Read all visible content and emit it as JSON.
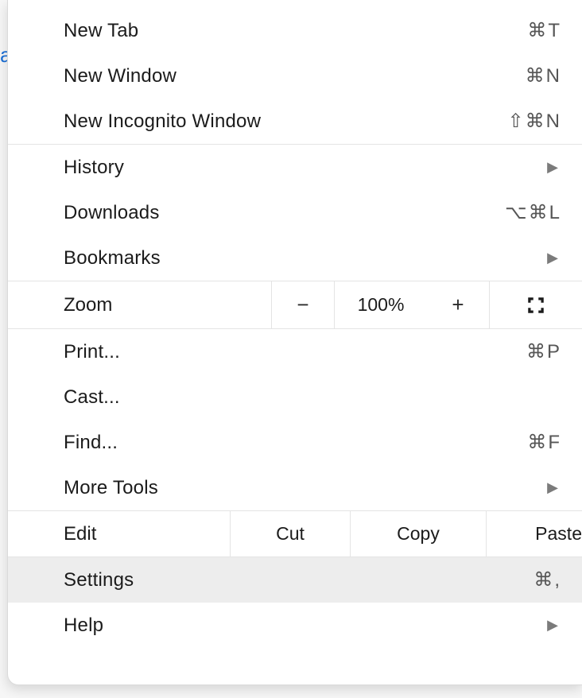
{
  "menu": {
    "items": {
      "new_tab": {
        "label": "New Tab",
        "shortcut": "⌘T"
      },
      "new_window": {
        "label": "New Window",
        "shortcut": "⌘N"
      },
      "new_incognito": {
        "label": "New Incognito Window",
        "shortcut": "⇧⌘N"
      },
      "history": {
        "label": "History"
      },
      "downloads": {
        "label": "Downloads",
        "shortcut": "⌥⌘L"
      },
      "bookmarks": {
        "label": "Bookmarks"
      },
      "zoom": {
        "label": "Zoom",
        "level": "100%",
        "minus": "−",
        "plus": "+"
      },
      "print": {
        "label": "Print...",
        "shortcut": "⌘P"
      },
      "cast": {
        "label": "Cast..."
      },
      "find": {
        "label": "Find...",
        "shortcut": "⌘F"
      },
      "more_tools": {
        "label": "More Tools"
      },
      "edit": {
        "label": "Edit",
        "cut": "Cut",
        "copy": "Copy",
        "paste": "Paste"
      },
      "settings": {
        "label": "Settings",
        "shortcut": "⌘,"
      },
      "help": {
        "label": "Help"
      }
    },
    "hovered": "settings"
  },
  "background_fragment": "a"
}
